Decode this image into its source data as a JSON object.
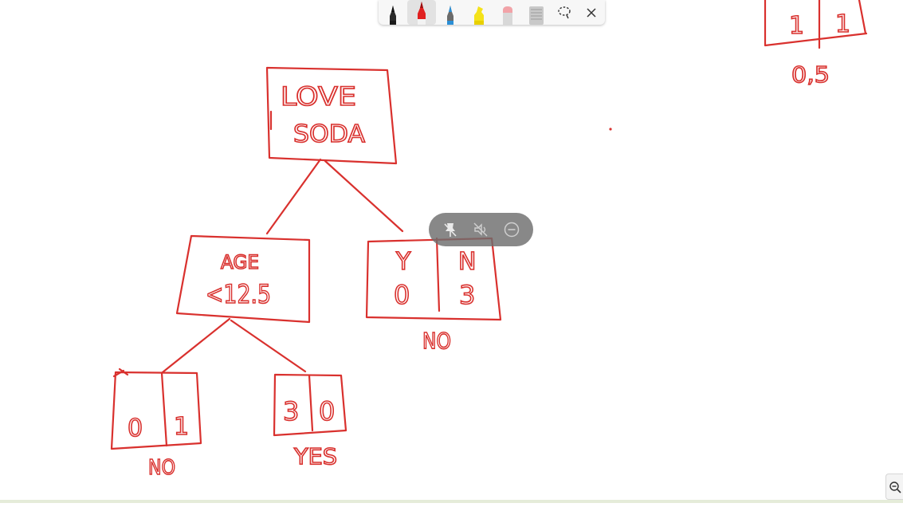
{
  "whiteboard": {
    "ink_color": "#d9312e",
    "root_node": {
      "line1": "LOVE",
      "line2": "SODA"
    },
    "age_node": {
      "line1": "AGE",
      "line2": "<12.5"
    },
    "right_leaf": {
      "y_label": "Y",
      "n_label": "N",
      "y_value": "0",
      "n_value": "3",
      "label": "NO"
    },
    "left_leaf": {
      "left_value": "0",
      "right_value": "1",
      "label": "NO"
    },
    "middle_leaf": {
      "left_value": "3",
      "right_value": "0",
      "label": "YES"
    },
    "top_right_partial": {
      "left_value": "1",
      "right_value": "1",
      "label": "0,5"
    }
  },
  "toolbar": {
    "tools": [
      {
        "name": "black-pen",
        "color": "#1f1f1f"
      },
      {
        "name": "red-pen",
        "color": "#e02020",
        "active": true
      },
      {
        "name": "blue-pen",
        "color": "#2b8fd6"
      },
      {
        "name": "yellow-highlighter",
        "color": "#f4e21a"
      },
      {
        "name": "pink-eraser",
        "color": "#f2a3a8"
      },
      {
        "name": "ruler",
        "color": "#bfbfbf"
      }
    ],
    "lasso_icon": "lasso-icon",
    "close_icon": "close-icon"
  },
  "floating_controls": {
    "icons": [
      "unpin-icon",
      "mute-icon",
      "minimize-icon"
    ]
  },
  "zoom_icon": "zoom-out-icon"
}
